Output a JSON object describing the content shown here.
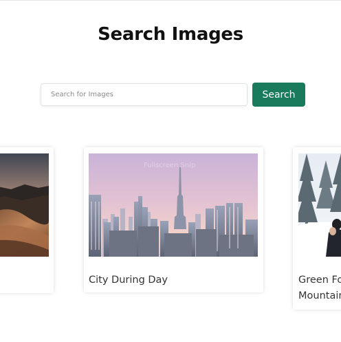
{
  "header": {
    "title": "Search Images"
  },
  "search": {
    "placeholder": "Search for Images",
    "value": "",
    "button_label": "Search"
  },
  "results": [
    {
      "caption": "",
      "image": "desert-dunes-dusk"
    },
    {
      "caption": "City During Day",
      "image": "dubai-skyline-pink-sky",
      "watermark": "Fullscreen Snip"
    },
    {
      "caption": "Green Forest Mountain",
      "image": "snowy-forest-couple"
    }
  ],
  "colors": {
    "accent": "#1a7a5c",
    "title": "#111111",
    "caption": "#333333"
  }
}
